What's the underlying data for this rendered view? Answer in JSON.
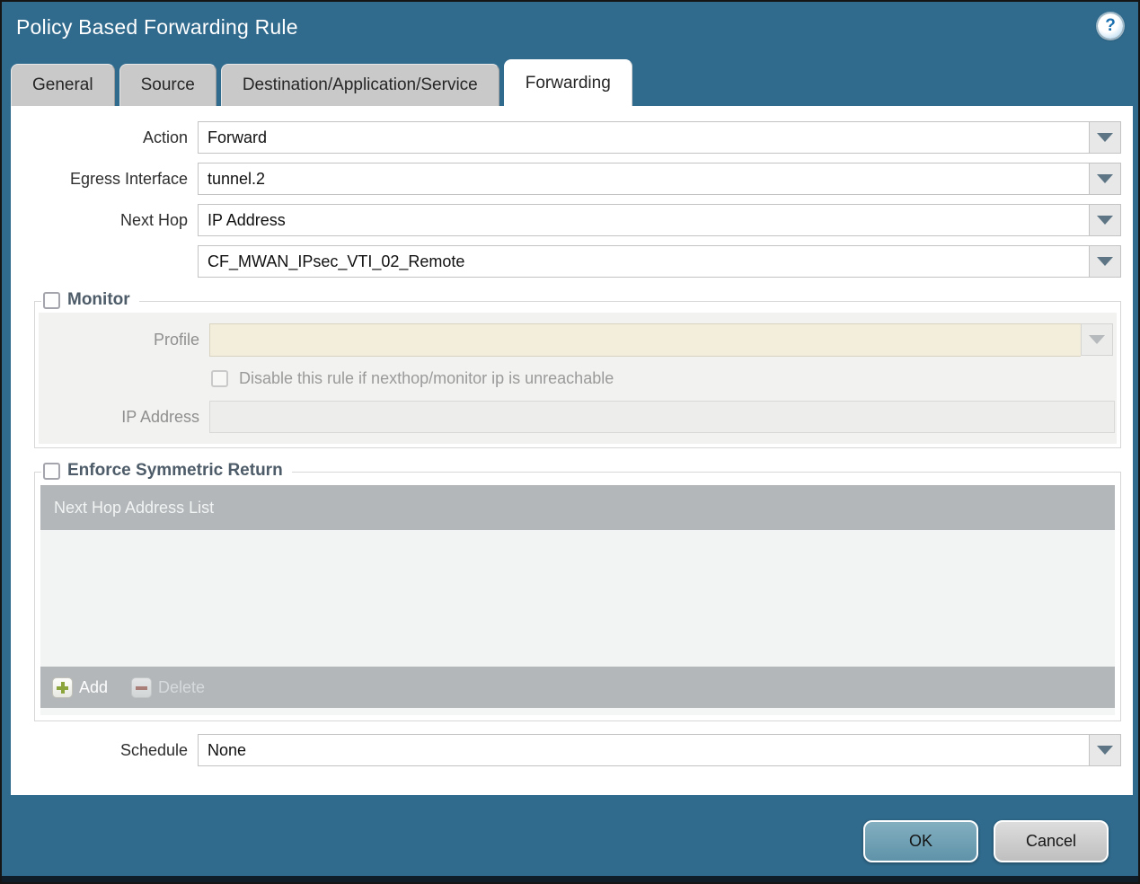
{
  "window": {
    "title": "Policy Based Forwarding Rule",
    "help_icon": "?"
  },
  "tabs": [
    {
      "label": "General",
      "active": false
    },
    {
      "label": "Source",
      "active": false
    },
    {
      "label": "Destination/Application/Service",
      "active": false
    },
    {
      "label": "Forwarding",
      "active": true
    }
  ],
  "form": {
    "action": {
      "label": "Action",
      "value": "Forward"
    },
    "egress_interface": {
      "label": "Egress Interface",
      "value": "tunnel.2"
    },
    "next_hop": {
      "label": "Next Hop",
      "value": "IP Address"
    },
    "next_hop_address": {
      "value": "CF_MWAN_IPsec_VTI_02_Remote"
    },
    "schedule": {
      "label": "Schedule",
      "value": "None"
    }
  },
  "monitor": {
    "legend": "Monitor",
    "checked": false,
    "profile": {
      "label": "Profile",
      "value": ""
    },
    "disable_rule_checkbox": {
      "label": "Disable this rule if nexthop/monitor ip is unreachable",
      "checked": false
    },
    "ip_address": {
      "label": "IP Address",
      "value": ""
    }
  },
  "enforce_symmetric_return": {
    "legend": "Enforce Symmetric Return",
    "checked": false,
    "table": {
      "header": "Next Hop Address List",
      "rows": [],
      "add_label": "Add",
      "delete_label": "Delete"
    }
  },
  "footer": {
    "ok_label": "OK",
    "cancel_label": "Cancel"
  },
  "colors": {
    "titlebar_bg": "#306a8c",
    "ok_button": "#6f9fb3",
    "table_header_bg": "#b3b7ba",
    "disabled_field_bg": "#f3eedb"
  }
}
